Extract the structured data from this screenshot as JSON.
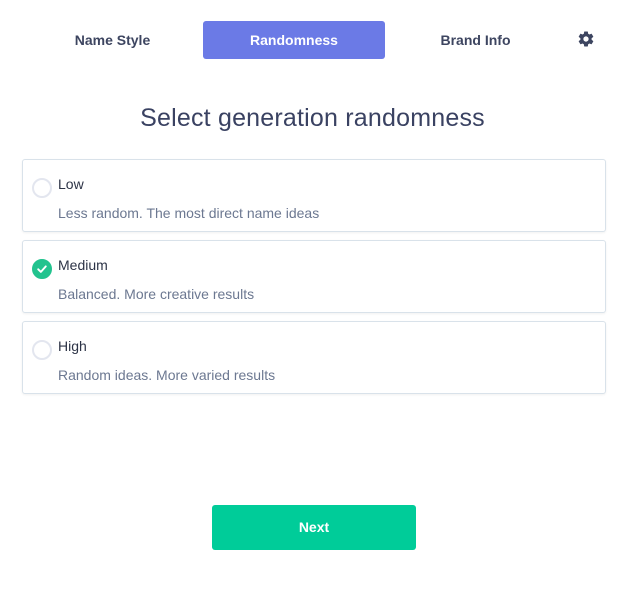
{
  "tabs": [
    {
      "label": "Name Style",
      "active": false
    },
    {
      "label": "Randomness",
      "active": true
    },
    {
      "label": "Brand Info",
      "active": false
    }
  ],
  "settings_icon": "gear-icon",
  "heading": "Select generation randomness",
  "options": [
    {
      "title": "Low",
      "description": "Less random. The most direct name ideas",
      "selected": false
    },
    {
      "title": "Medium",
      "description": "Balanced. More creative results",
      "selected": true
    },
    {
      "title": "High",
      "description": "Random ideas. More varied results",
      "selected": false
    }
  ],
  "next_label": "Next",
  "colors": {
    "accent": "#6b7ae6",
    "success": "#22c38e",
    "button": "#00cc99",
    "text_dark": "#3a4262",
    "text_muted": "#6c7891",
    "border": "#d9e2ea"
  }
}
